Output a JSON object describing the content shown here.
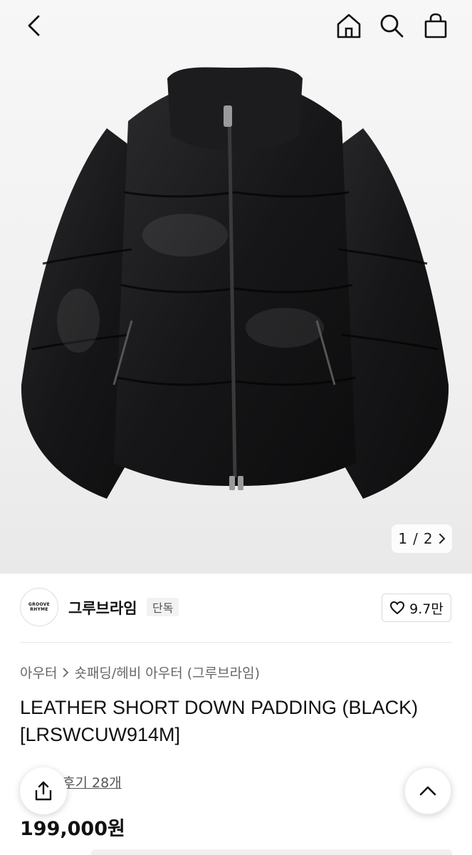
{
  "pager": {
    "current": "1",
    "separator": "/",
    "total": "2",
    "next_icon": "chevron-right-icon"
  },
  "brand": {
    "logo_text": "GROOVE RHYME",
    "name": "그루브라임",
    "tag": "단독",
    "likes": "9.7만"
  },
  "breadcrumb": {
    "category": "아우터",
    "subcategory": "숏패딩/헤비 아우터 (그루브라임)"
  },
  "product": {
    "title_line1": "LEATHER SHORT DOWN PADDING (BLACK)",
    "title_line2": "[LRSWCUW914M]",
    "review_link": "후기 28개",
    "price": "199,000원"
  },
  "icons": {
    "back": "back-arrow-icon",
    "home": "home-icon",
    "search": "search-icon",
    "cart": "shopping-bag-icon",
    "like": "heart-icon",
    "share": "share-icon",
    "scroll_top": "chevron-up-icon"
  },
  "colors": {
    "accent_star": "#f5a623",
    "text_primary": "#111111",
    "text_secondary": "#666666"
  }
}
